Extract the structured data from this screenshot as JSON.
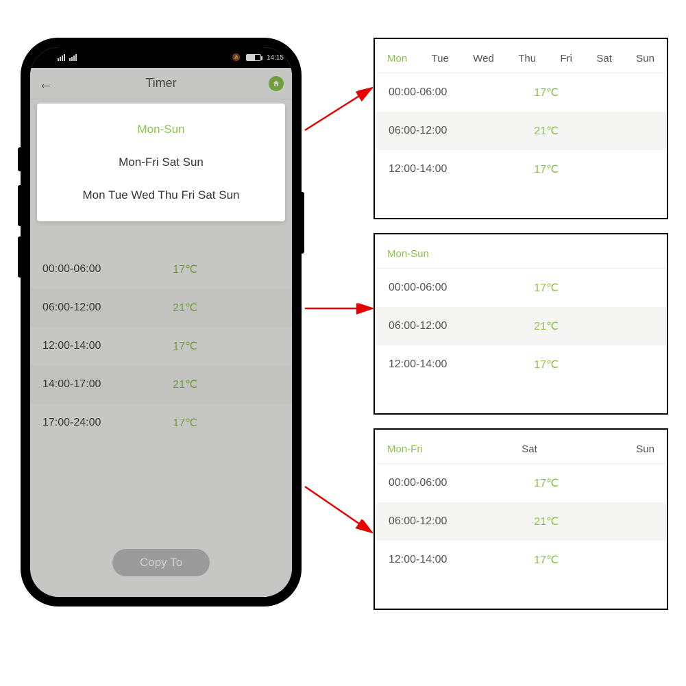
{
  "statusbar": {
    "battery_text": "60",
    "time": "14:15"
  },
  "header": {
    "title": "Timer"
  },
  "popup": {
    "options": [
      {
        "label": "Mon-Sun",
        "active": true
      },
      {
        "label": "Mon-Fri Sat Sun",
        "active": false
      },
      {
        "label": "Mon Tue Wed Thu Fri Sat Sun",
        "active": false
      }
    ]
  },
  "phone_schedule": [
    {
      "time": "00:00-06:00",
      "temp": "17℃"
    },
    {
      "time": "06:00-12:00",
      "temp": "21℃"
    },
    {
      "time": "12:00-14:00",
      "temp": "17℃"
    },
    {
      "time": "14:00-17:00",
      "temp": "21℃"
    },
    {
      "time": "17:00-24:00",
      "temp": "17℃"
    }
  ],
  "copy_button": "Copy To",
  "panels": {
    "p1": {
      "days": [
        {
          "label": "Mon",
          "active": true
        },
        {
          "label": "Tue"
        },
        {
          "label": "Wed"
        },
        {
          "label": "Thu"
        },
        {
          "label": "Fri"
        },
        {
          "label": "Sat"
        },
        {
          "label": "Sun"
        }
      ],
      "rows": [
        {
          "time": "00:00-06:00",
          "temp": "17℃"
        },
        {
          "time": "06:00-12:00",
          "temp": "21℃"
        },
        {
          "time": "12:00-14:00",
          "temp": "17℃"
        }
      ]
    },
    "p2": {
      "days": [
        {
          "label": "Mon-Sun",
          "active": true
        }
      ],
      "rows": [
        {
          "time": "00:00-06:00",
          "temp": "17℃"
        },
        {
          "time": "06:00-12:00",
          "temp": "21℃"
        },
        {
          "time": "12:00-14:00",
          "temp": "17℃"
        }
      ]
    },
    "p3": {
      "days": [
        {
          "label": "Mon-Fri",
          "active": true
        },
        {
          "label": "Sat"
        },
        {
          "label": "Sun"
        }
      ],
      "rows": [
        {
          "time": "00:00-06:00",
          "temp": "17℃"
        },
        {
          "time": "06:00-12:00",
          "temp": "21℃"
        },
        {
          "time": "12:00-14:00",
          "temp": "17℃"
        }
      ]
    }
  }
}
